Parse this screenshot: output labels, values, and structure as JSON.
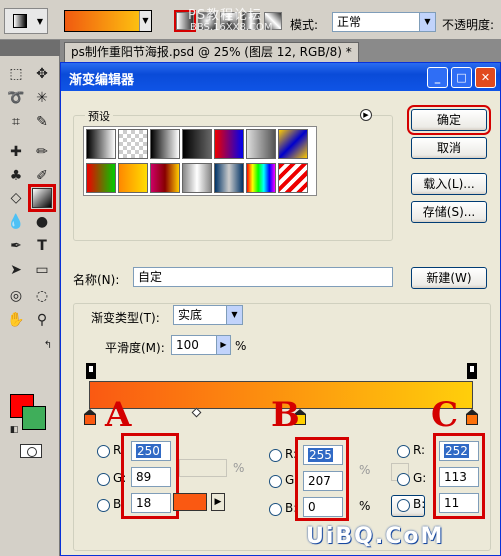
{
  "top_bar": {
    "watermark_line1": "PS教程论坛",
    "watermark_line2": "BBS.16XX8.COM",
    "mode_label": "模式:",
    "mode_value": "正常",
    "opacity_label": "不透明度:"
  },
  "document_tab": "ps制作重阳节海报.psd @ 25% (图层 12, RGB/8) *",
  "toolbox": {
    "foreground_color": "#ff0000",
    "background_color": "#3fae5a"
  },
  "dialog": {
    "title": "渐变编辑器",
    "presets_label": "预设",
    "buttons": {
      "ok": "确定",
      "cancel": "取消",
      "load": "载入(L)...",
      "save": "存储(S)..."
    },
    "name_label": "名称(N):",
    "name_value": "自定",
    "new_button": "新建(W)",
    "gradient_type_label": "渐变类型(T):",
    "gradient_type_value": "实底",
    "smoothness_label": "平滑度(M):",
    "smoothness_value": "100",
    "smoothness_unit": "%",
    "gradient_colors": {
      "start": "#fa5912",
      "end": "#ffcf0b"
    }
  },
  "annotations": [
    "A",
    "B",
    "C"
  ],
  "stops": {
    "A": {
      "R": "250",
      "G": "89",
      "B": "18",
      "color": "#fa5912"
    },
    "B": {
      "R": "255",
      "G": "207",
      "B": "0",
      "color": "#ffcf00"
    },
    "C": {
      "R": "252",
      "G": "113",
      "B": "11",
      "color": "#fc710b"
    }
  },
  "channel_labels": {
    "r": "R:",
    "g": "G:",
    "b": "B:"
  },
  "percent_sign": "%",
  "watermark_bottom": "UiBQ.CoM"
}
